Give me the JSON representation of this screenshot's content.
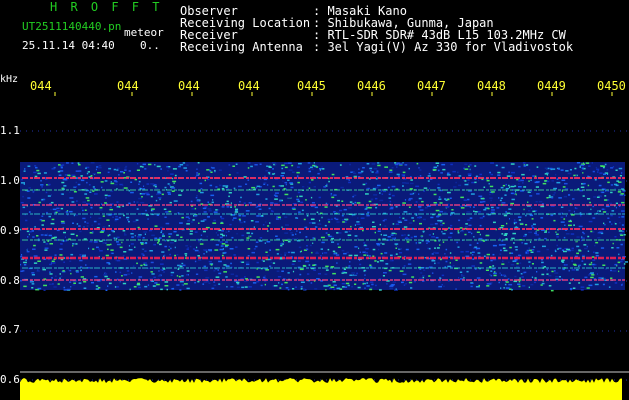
{
  "header": {
    "brand": "H R O F F T",
    "filename": "UT2511140440.pn",
    "meteor_label": "meteor",
    "datetime": "25.11.14 04:40",
    "datetime_value": "0..",
    "fields": [
      {
        "label": "Observer",
        "value": ": Masaki Kano"
      },
      {
        "label": "Receiving Location",
        "value": ": Shibukawa, Gunma, Japan"
      },
      {
        "label": "Receiver",
        "value": ": RTL-SDR SDR# 43dB L15 103.2MHz CW"
      },
      {
        "label": "Receiving Antenna",
        "value": ": 3el Yagi(V) Az 330 for Vladivostok"
      }
    ]
  },
  "axis": {
    "unit": "kHz",
    "time_ticks": [
      "044",
      "044",
      "044",
      "044",
      "0445",
      "0446",
      "0447",
      "0448",
      "0449",
      "0450"
    ],
    "freq_ticks": [
      "1.1",
      "1.0",
      "0.9",
      "0.8",
      "0.7",
      "0.6"
    ]
  },
  "colors": {
    "text_green": "#22cc22",
    "text_yellow": "#ffff33",
    "background": "#000000"
  }
}
